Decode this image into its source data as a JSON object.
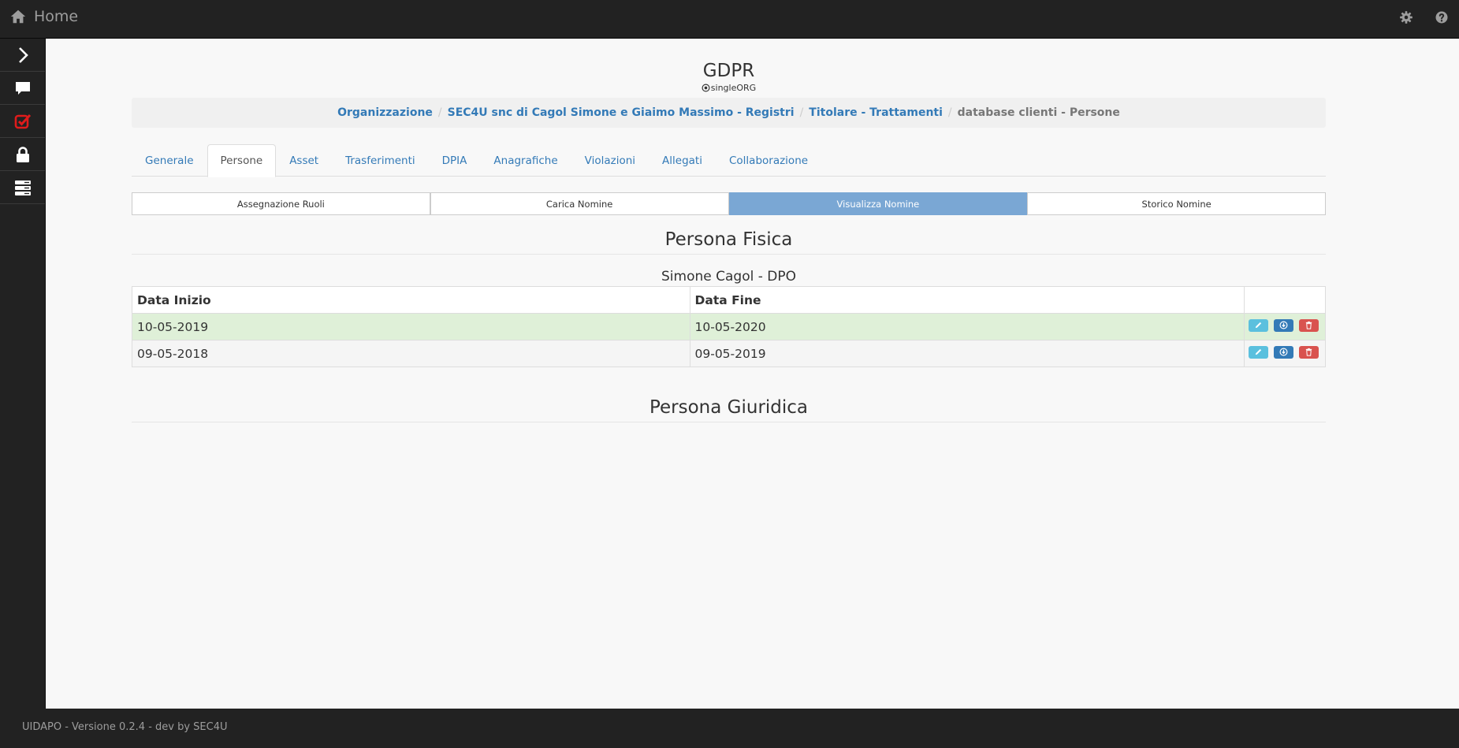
{
  "topbar": {
    "home_label": "Home"
  },
  "sidebar": {
    "items": [
      {
        "icon": "chevron-right-icon",
        "color": "#ffffff"
      },
      {
        "icon": "chat-icon",
        "color": "#ffffff"
      },
      {
        "icon": "checkbox-icon",
        "color": "#e01b1b"
      },
      {
        "icon": "lock-icon",
        "color": "#ffffff"
      },
      {
        "icon": "server-icon",
        "color": "#ffffff"
      }
    ]
  },
  "header": {
    "title": "GDPR",
    "subtitle": "singleORG"
  },
  "breadcrumb": {
    "items": [
      "Organizzazione",
      "SEC4U snc di Cagol Simone e Giaimo Massimo - Registri",
      "Titolare - Trattamenti"
    ],
    "active": "database clienti - Persone"
  },
  "tabs": [
    "Generale",
    "Persone",
    "Asset",
    "Trasferimenti",
    "DPIA",
    "Anagrafiche",
    "Violazioni",
    "Allegati",
    "Collaborazione"
  ],
  "active_tab": "Persone",
  "subnav": [
    "Assegnazione Ruoli",
    "Carica Nomine",
    "Visualizza Nomine",
    "Storico Nomine"
  ],
  "active_subnav": "Visualizza Nomine",
  "sections": {
    "fisica_title": "Persona Fisica",
    "giuridica_title": "Persona Giuridica"
  },
  "person": {
    "name": "Simone Cagol - DPO",
    "columns": [
      "Data Inizio",
      "Data Fine"
    ],
    "rows": [
      {
        "start": "10-05-2019",
        "end": "10-05-2020"
      },
      {
        "start": "09-05-2018",
        "end": "09-05-2019"
      }
    ]
  },
  "footer": {
    "text": "UIDAPO - Versione 0.2.4 - dev by SEC4U"
  },
  "colors": {
    "accent": "#337ab7",
    "info": "#5bc0de",
    "danger": "#d9534f",
    "success_row": "#dff0d8",
    "active_segment": "#7aa7d4"
  }
}
